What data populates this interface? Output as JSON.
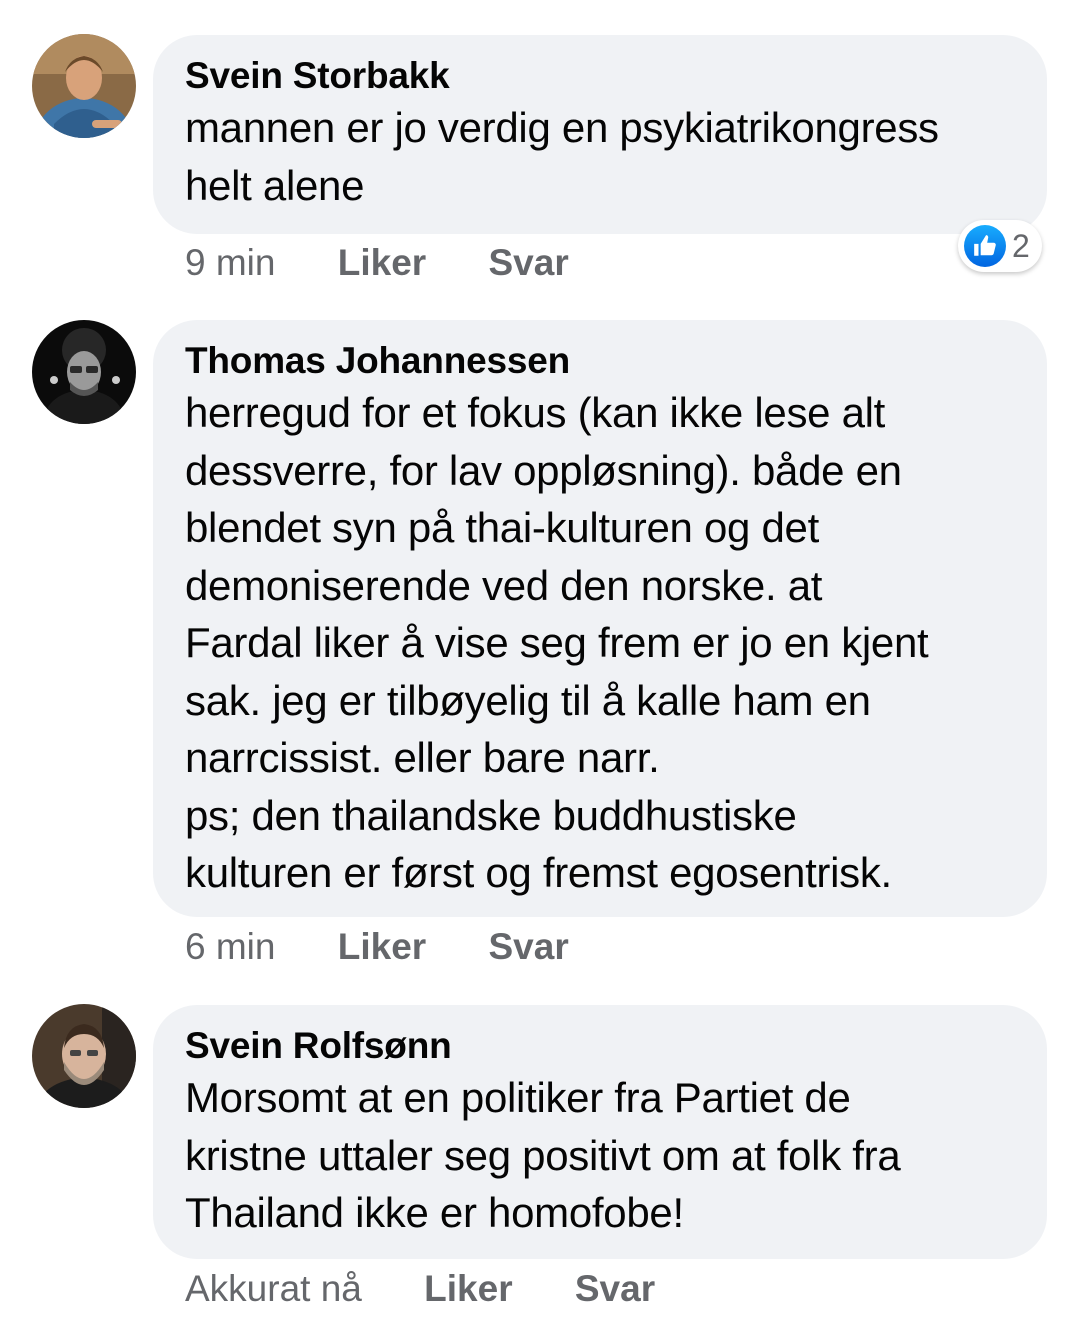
{
  "comments": [
    {
      "author": "Svein Storbakk",
      "text": "mannen er jo verdig en psykiatrikongress\nhelt alene",
      "time": "9 min",
      "like_label": "Liker",
      "reply_label": "Svar",
      "reaction_count": "2",
      "reaction_icon": "like-icon",
      "reaction_color": "#0866ff"
    },
    {
      "author": "Thomas Johannessen",
      "text": "herregud for et fokus (kan ikke lese alt\ndessverre, for lav oppløsning). både en\nblendet syn på thai-kulturen og det\ndemoniserende ved den norske. at\nFardal liker å vise seg frem er jo en kjent\nsak.  jeg er tilbøyelig til å kalle ham en\nnarrcissist. eller bare narr.\nps; den thailandske buddhustiske\nkulturen er først og fremst egosentrisk.",
      "time": "6 min",
      "like_label": "Liker",
      "reply_label": "Svar"
    },
    {
      "author": "Svein Rolfsønn",
      "text": "Morsomt at en politiker fra Partiet de\nkristne uttaler seg positivt om at folk fra\nThailand ikke er homofobe!",
      "time": "Akkurat nå",
      "like_label": "Liker",
      "reply_label": "Svar"
    }
  ],
  "colors": {
    "bubble": "#f0f2f5",
    "meta_text": "#65676b",
    "body_text": "#050505"
  }
}
